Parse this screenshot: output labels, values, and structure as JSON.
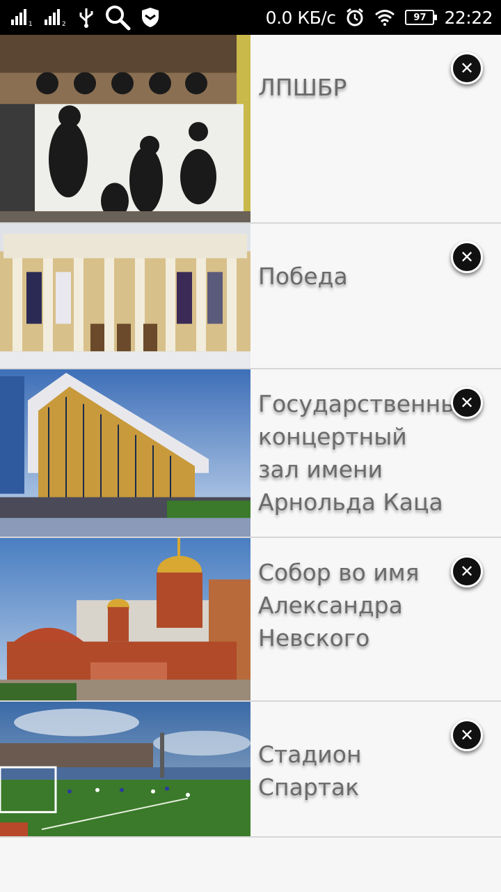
{
  "status_bar": {
    "network_speed": "0.0 КБ/с",
    "battery": "97",
    "time": "22:22",
    "icons": [
      "signal-sim1-icon",
      "signal-sim2-icon",
      "usb-icon",
      "search-icon",
      "shield-icon",
      "alarm-icon",
      "wifi-icon",
      "battery-icon"
    ]
  },
  "places": [
    {
      "title": "ЛПШБР",
      "image": "lpshbr-mural-photo"
    },
    {
      "title": "Победа",
      "image": "pobeda-cinema-photo"
    },
    {
      "title": "Государственный концертный зал имени Арнольда Каца",
      "image": "concert-hall-photo"
    },
    {
      "title": "Собор во имя Александра Невского",
      "image": "cathedral-photo"
    },
    {
      "title": "Стадион Спартак",
      "image": "spartak-stadium-photo"
    }
  ],
  "close_glyph": "✕"
}
